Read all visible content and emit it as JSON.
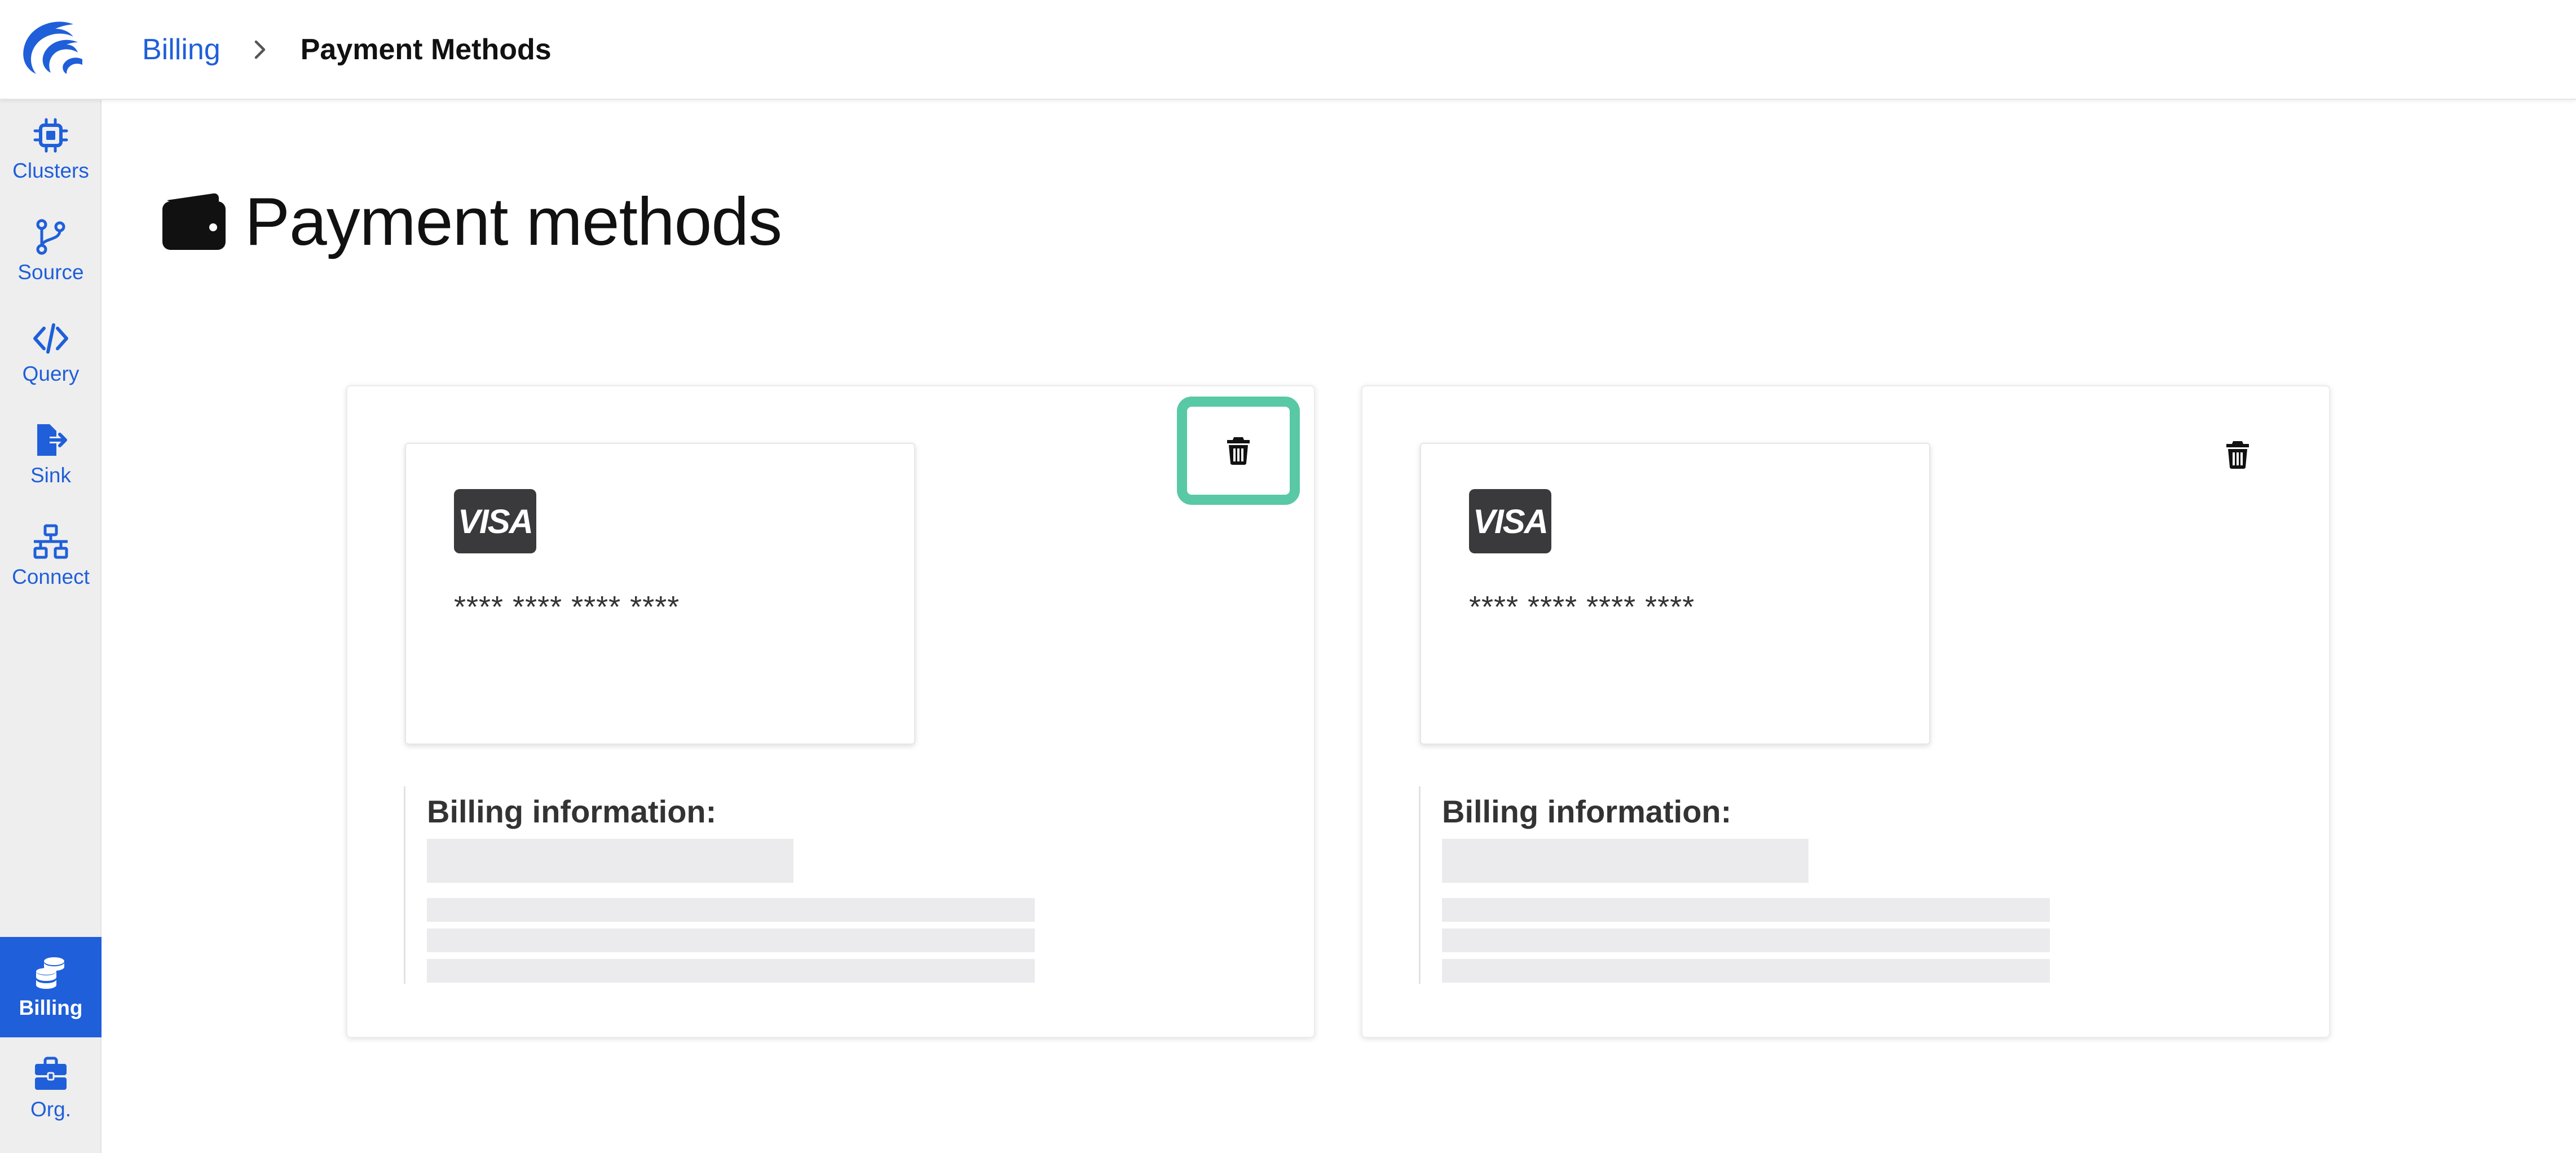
{
  "breadcrumb": {
    "parent": "Billing",
    "current": "Payment Methods"
  },
  "sidebar": {
    "items": [
      {
        "label": "Clusters",
        "icon": "cpu-chip-icon"
      },
      {
        "label": "Source",
        "icon": "git-branch-icon"
      },
      {
        "label": "Query",
        "icon": "code-icon"
      },
      {
        "label": "Sink",
        "icon": "file-export-icon"
      },
      {
        "label": "Connect",
        "icon": "network-icon"
      },
      {
        "label": "Billing",
        "icon": "coins-icon",
        "active": true
      },
      {
        "label": "Org.",
        "icon": "briefcase-icon"
      }
    ]
  },
  "page": {
    "title": "Payment methods",
    "title_icon": "wallet-icon"
  },
  "payment_methods": [
    {
      "brand": "VISA",
      "number": "**** **** **** ****",
      "billing_heading": "Billing information:",
      "delete_focused": true
    },
    {
      "brand": "VISA",
      "number": "**** **** **** ****",
      "billing_heading": "Billing information:",
      "delete_focused": false
    }
  ],
  "colors": {
    "accent": "#1f5fd9",
    "focus_ring": "#58c9a4",
    "sidebar_bg": "#eeeeef",
    "skeleton": "#ebebed",
    "visa_badge": "#3a3a3c"
  }
}
